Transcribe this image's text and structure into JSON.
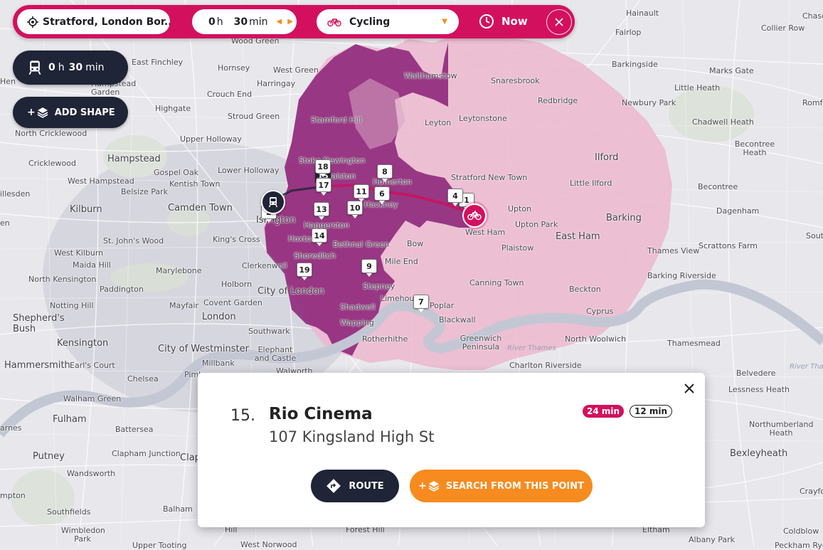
{
  "search": {
    "location": "Stratford, London Bor...",
    "hours": "0",
    "hours_unit": "h",
    "minutes": "30",
    "minutes_unit": "min",
    "mode": "Cycling",
    "time_label": "Now"
  },
  "left_panel": {
    "transit_hours": "0",
    "transit_h_unit": "h",
    "transit_minutes": "30",
    "transit_min_unit": "min",
    "add_shape_label": "ADD SHAPE"
  },
  "popup": {
    "index": "15.",
    "title": "Rio Cinema",
    "address": "107 Kingsland High St",
    "badge_primary": "24 min",
    "badge_secondary": "12 min",
    "route_label": "ROUTE",
    "search_label": "SEARCH FROM THIS POINT"
  },
  "colors": {
    "brand": "#d3105e",
    "dark": "#1f2436",
    "orange": "#f78b1f",
    "isochrone_light": "#ecb7cf",
    "isochrone_dark": "#8a1e76"
  },
  "markers": [
    "1",
    "2",
    "4",
    "6",
    "7",
    "8",
    "9",
    "10",
    "11",
    "13",
    "14",
    "15",
    "17",
    "18",
    "19"
  ],
  "places": [
    {
      "id": "hainault",
      "label": "Hainault"
    },
    {
      "id": "chase",
      "label": "Chase"
    },
    {
      "id": "collier_row",
      "label": "Collier Row"
    },
    {
      "id": "fairlop",
      "label": "Fairlop"
    },
    {
      "id": "wood_green",
      "label": "Wood Green"
    },
    {
      "id": "east_finchley",
      "label": "East Finchley"
    },
    {
      "id": "hornsey",
      "label": "Hornsey"
    },
    {
      "id": "west_green",
      "label": "West Green"
    },
    {
      "id": "walthamstow",
      "label": "Walthamstow"
    },
    {
      "id": "barkingside",
      "label": "Barkingside"
    },
    {
      "id": "marks_gate",
      "label": "Marks Gate"
    },
    {
      "id": "hampstead_garden_suburb",
      "label": "Hampstead Garden Suburb"
    },
    {
      "id": "harringay",
      "label": "Harringay"
    },
    {
      "id": "snaresbrook",
      "label": "Snaresbrook"
    },
    {
      "id": "little_heath",
      "label": "Little Heath"
    },
    {
      "id": "highgate",
      "label": "Highgate"
    },
    {
      "id": "crouch_end",
      "label": "Crouch End"
    },
    {
      "id": "redbridge",
      "label": "Redbridge"
    },
    {
      "id": "newbury_park",
      "label": "Newbury Park"
    },
    {
      "id": "romford",
      "label": "Romf"
    },
    {
      "id": "stroud_green",
      "label": "Stroud Green"
    },
    {
      "id": "stamford_hill",
      "label": "Stamford Hill"
    },
    {
      "id": "leytonstone",
      "label": "Leytonstone"
    },
    {
      "id": "chadwell_heath",
      "label": "Chadwell Heath"
    },
    {
      "id": "north_cricklewood",
      "label": "North Cricklewood"
    },
    {
      "id": "leyton",
      "label": "Leyton"
    },
    {
      "id": "upper_holloway",
      "label": "Upper Holloway"
    },
    {
      "id": "becontree_heath",
      "label": "Becontree Heath"
    },
    {
      "id": "cricklewood",
      "label": "Cricklewood"
    },
    {
      "id": "hampstead",
      "label": "Hampstead"
    },
    {
      "id": "stoke_newington",
      "label": "Stoke Newington"
    },
    {
      "id": "ilford",
      "label": "Ilford"
    },
    {
      "id": "gospel_oak",
      "label": "Gospel Oak"
    },
    {
      "id": "lower_holloway",
      "label": "Lower Holloway"
    },
    {
      "id": "dalston",
      "label": "Dalston"
    },
    {
      "id": "homerton",
      "label": "Homerton"
    },
    {
      "id": "west_hampstead",
      "label": "West Hampstead"
    },
    {
      "id": "kentish_town",
      "label": "Kentish Town"
    },
    {
      "id": "stratford_new_town",
      "label": "Stratford New Town"
    },
    {
      "id": "little_ilford",
      "label": "Little Ilford"
    },
    {
      "id": "becontree",
      "label": "Becontree"
    },
    {
      "id": "willesden",
      "label": "illesden"
    },
    {
      "id": "belsize_park",
      "label": "Belsize Park"
    },
    {
      "id": "hackney",
      "label": "Hackney"
    },
    {
      "id": "kilburn",
      "label": "Kilburn"
    },
    {
      "id": "camden_town",
      "label": "Camden Town"
    },
    {
      "id": "upton",
      "label": "Upton"
    },
    {
      "id": "dagenham",
      "label": "Dagenham"
    },
    {
      "id": "barking",
      "label": "Barking"
    },
    {
      "id": "islington",
      "label": "Islington"
    },
    {
      "id": "haggerston",
      "label": "Haggerston"
    },
    {
      "id": "upton_park",
      "label": "Upton Park"
    },
    {
      "id": "west_ham",
      "label": "West Ham"
    },
    {
      "id": "south",
      "label": "Sout"
    },
    {
      "id": "st_johns_wood",
      "label": "St. John's Wood"
    },
    {
      "id": "kings_cross",
      "label": "King's Cross"
    },
    {
      "id": "hoxton",
      "label": "Hoxton"
    },
    {
      "id": "bow",
      "label": "Bow"
    },
    {
      "id": "east_ham",
      "label": "East Ham"
    },
    {
      "id": "scrattons_farm",
      "label": "Scrattons Farm"
    },
    {
      "id": "bethnal_green",
      "label": "Bethnal Green"
    },
    {
      "id": "plaistow",
      "label": "Plaistow"
    },
    {
      "id": "thames_view",
      "label": "Thames View"
    },
    {
      "id": "west_kilburn",
      "label": "West Kilburn"
    },
    {
      "id": "shoreditch",
      "label": "Shoreditch"
    },
    {
      "id": "maida_hill",
      "label": "Maida Hill"
    },
    {
      "id": "clerkenwell",
      "label": "Clerkenwell"
    },
    {
      "id": "mile_end",
      "label": "Mile End"
    },
    {
      "id": "marylebone",
      "label": "Marylebone"
    },
    {
      "id": "barking_riverside",
      "label": "Barking Riverside"
    },
    {
      "id": "north_kensington",
      "label": "North Kensington"
    },
    {
      "id": "holborn",
      "label": "Holborn"
    },
    {
      "id": "paddington",
      "label": "Paddington"
    },
    {
      "id": "canning_town",
      "label": "Canning Town"
    },
    {
      "id": "stepney",
      "label": "Stepney"
    },
    {
      "id": "city_of_london",
      "label": "City of London"
    },
    {
      "id": "beckton",
      "label": "Beckton"
    },
    {
      "id": "limehouse",
      "label": "Limehouse"
    },
    {
      "id": "poplar",
      "label": "Poplar"
    },
    {
      "id": "notting_hill",
      "label": "Notting Hill"
    },
    {
      "id": "mayfair",
      "label": "Mayfair"
    },
    {
      "id": "covent_garden",
      "label": "Covent Garden"
    },
    {
      "id": "cyprus",
      "label": "Cyprus"
    },
    {
      "id": "shadwell",
      "label": "Shadwell"
    },
    {
      "id": "shepherds_bush",
      "label": "Shepherd's Bush"
    },
    {
      "id": "london",
      "label": "London"
    },
    {
      "id": "wapping",
      "label": "Wapping"
    },
    {
      "id": "blackwall",
      "label": "Blackwall"
    },
    {
      "id": "southwark",
      "label": "Southwark"
    },
    {
      "id": "north_woolwich",
      "label": "North Woolwich"
    },
    {
      "id": "rotherhithe",
      "label": "Rotherhithe"
    },
    {
      "id": "greenwich_peninsula",
      "label": "Greenwich Peninsula"
    },
    {
      "id": "kensington",
      "label": "Kensington"
    },
    {
      "id": "thamesmead",
      "label": "Thamesmead"
    },
    {
      "id": "river_thames",
      "label": "River Thames"
    },
    {
      "id": "city_of_westminster",
      "label": "City of Westminster"
    },
    {
      "id": "elephant_and_castle",
      "label": "Elephant and Castle"
    },
    {
      "id": "hammersmith",
      "label": "Hammersmith"
    },
    {
      "id": "earls_court",
      "label": "Earl's Court"
    },
    {
      "id": "millbank",
      "label": "Millbank"
    },
    {
      "id": "charlton_riverside",
      "label": "Charlton Riverside"
    },
    {
      "id": "river_thames_right",
      "label": "River Tha"
    },
    {
      "id": "walworth",
      "label": "Walworth"
    },
    {
      "id": "belvedere",
      "label": "Belvedere"
    },
    {
      "id": "pimlico",
      "label": "Piml"
    },
    {
      "id": "chelsea",
      "label": "Chelsea"
    },
    {
      "id": "lessness_heath",
      "label": "Lessness Heath"
    },
    {
      "id": "walham_green",
      "label": "Walham Green"
    },
    {
      "id": "fulham",
      "label": "Fulham"
    },
    {
      "id": "barnes",
      "label": "arnes"
    },
    {
      "id": "battersea",
      "label": "Battersea"
    },
    {
      "id": "northumberland_heath",
      "label": "Northumberland Heath"
    },
    {
      "id": "putney",
      "label": "Putney"
    },
    {
      "id": "clapham_junction",
      "label": "Clapham Junction"
    },
    {
      "id": "clap",
      "label": "Clap"
    },
    {
      "id": "bexleyheath",
      "label": "Bexleyheath"
    },
    {
      "id": "wandsworth",
      "label": "Wandsworth"
    },
    {
      "id": "crayford",
      "label": "Crayfo"
    },
    {
      "id": "hampton",
      "label": "mpton"
    },
    {
      "id": "southfields",
      "label": "Southfields"
    },
    {
      "id": "balham",
      "label": "Balham"
    },
    {
      "id": "wimbledon_park",
      "label": "Wimbledon Park"
    },
    {
      "id": "hill",
      "label": "Hill"
    },
    {
      "id": "forest_hill",
      "label": "Forest Hill"
    },
    {
      "id": "eltham",
      "label": "Eltham"
    },
    {
      "id": "coldblow",
      "label": "Coldblow"
    },
    {
      "id": "west_norwood",
      "label": "West Norwood"
    },
    {
      "id": "upper_tooting",
      "label": "Upper Tooting"
    },
    {
      "id": "peckham_rye",
      "label": "Peckham Rye"
    },
    {
      "id": "albany_park",
      "label": "Albany Park"
    },
    {
      "id": "hen",
      "label": "Hen"
    },
    {
      "id": "en",
      "label": "en"
    }
  ]
}
